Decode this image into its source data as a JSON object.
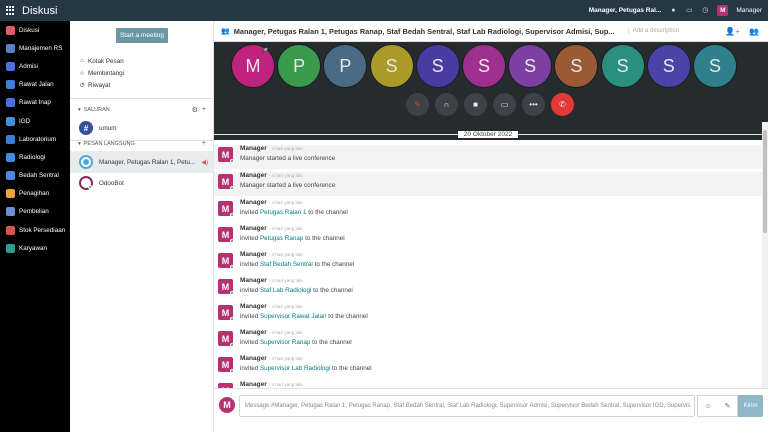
{
  "topbar": {
    "app_title": "Diskusi",
    "company": "Manager, Petugas Ral...",
    "user_initial": "M",
    "user_name": "Manager"
  },
  "appnav": {
    "items": [
      {
        "label": "Diskusi",
        "color": "#e35a6b"
      },
      {
        "label": "Manajemen RS",
        "color": "#5b7fc9"
      },
      {
        "label": "Admisi",
        "color": "#4b6fe0"
      },
      {
        "label": "Rawat Jalan",
        "color": "#3d80d8"
      },
      {
        "label": "Rawat Inap",
        "color": "#4a6fe3"
      },
      {
        "label": "IGD",
        "color": "#3f8fdc"
      },
      {
        "label": "Laboratorium",
        "color": "#3b7ed6"
      },
      {
        "label": "Radiologi",
        "color": "#3a8ee0"
      },
      {
        "label": "Bedah Sentral",
        "color": "#4a86e8"
      },
      {
        "label": "Penagihan",
        "color": "#f0a040"
      },
      {
        "label": "Pembelian",
        "color": "#6c8ed8"
      },
      {
        "label": "Stok Persediaan",
        "color": "#d9534f"
      },
      {
        "label": "Karyawan",
        "color": "#2f9e8f"
      }
    ]
  },
  "sidebar": {
    "start_meeting": "Start a meeting",
    "boxes": [
      {
        "label": "Kotak Pesan",
        "icon": "inbox-icon"
      },
      {
        "label": "Membintangi",
        "icon": "star-icon"
      },
      {
        "label": "Riwayat",
        "icon": "history-icon"
      }
    ],
    "channels_header": "SALURAN",
    "channel": {
      "label": "umum",
      "icon": "hash-icon"
    },
    "dm_header": "PESAN LANGSUNG",
    "dms": [
      {
        "label": "Manager, Petugas Ralan 1, Petu..."
      },
      {
        "label": "OdooBot"
      }
    ]
  },
  "thread": {
    "title": "Manager, Petugas Ralan 1, Petugas Ranap, Staf Bedah Sentral, Staf Lab Radiologi, Supervisor Admisi, Sup...",
    "description_placeholder": "Add a description"
  },
  "rtc": {
    "participants": [
      {
        "initial": "M",
        "color": "#c0237f",
        "muted": true
      },
      {
        "initial": "P",
        "color": "#3a9b4c"
      },
      {
        "initial": "P",
        "color": "#4a6b86"
      },
      {
        "initial": "S",
        "color": "#a99a2a"
      },
      {
        "initial": "S",
        "color": "#4a3ba3"
      },
      {
        "initial": "S",
        "color": "#a0308f"
      },
      {
        "initial": "S",
        "color": "#7d3fa1"
      },
      {
        "initial": "S",
        "color": "#9a5a36"
      },
      {
        "initial": "S",
        "color": "#2b8f7d"
      },
      {
        "initial": "S",
        "color": "#4a43a8"
      },
      {
        "initial": "S",
        "color": "#2f7f8c"
      }
    ]
  },
  "messages": {
    "date": "20 Oktober 2022",
    "items": [
      {
        "author": "Manager",
        "time": "- 4 hari yang lalu",
        "pre": "Manager started a live conference",
        "link": "",
        "post": "",
        "hl": true
      },
      {
        "author": "Manager",
        "time": "- 4 hari yang lalu",
        "pre": "Manager started a live conference",
        "link": "",
        "post": "",
        "hl": true
      },
      {
        "author": "Manager",
        "time": "- 4 hari yang lalu",
        "pre": "invited ",
        "link": "Petugas Ralan 1",
        "post": " to the channel",
        "hl": false
      },
      {
        "author": "Manager",
        "time": "- 4 hari yang lalu",
        "pre": "invited ",
        "link": "Petugas Ranap",
        "post": " to the channel",
        "hl": false
      },
      {
        "author": "Manager",
        "time": "- 4 hari yang lalu",
        "pre": "invited ",
        "link": "Staf Bedah Sentral",
        "post": " to the channel",
        "hl": false
      },
      {
        "author": "Manager",
        "time": "- 4 hari yang lalu",
        "pre": "invited ",
        "link": "Staf Lab Radiologi",
        "post": " to the channel",
        "hl": false
      },
      {
        "author": "Manager",
        "time": "- 4 hari yang lalu",
        "pre": "invited ",
        "link": "Supervisor Rawat Jalan",
        "post": " to the channel",
        "hl": false
      },
      {
        "author": "Manager",
        "time": "- 4 hari yang lalu",
        "pre": "invited ",
        "link": "Supervisor Ranap",
        "post": " to the channel",
        "hl": false
      },
      {
        "author": "Manager",
        "time": "- 4 hari yang lalu",
        "pre": "invited ",
        "link": "Supervisor Lab Radiologi",
        "post": " to the channel",
        "hl": false
      },
      {
        "author": "Manager",
        "time": "- 4 hari yang lalu",
        "pre": "",
        "link": "",
        "post": "",
        "hl": false
      }
    ]
  },
  "composer": {
    "avatar_initial": "M",
    "placeholder": "Message #Manager, Petugas Ralan 1, Petugas Ranap, Staf Bedah Sentral, Staf Lab Radiologi, Supervisor Admisi, Supervisor Bedah Sentral, Supervisor IGD, Supervis",
    "send_label": "Kirim"
  }
}
